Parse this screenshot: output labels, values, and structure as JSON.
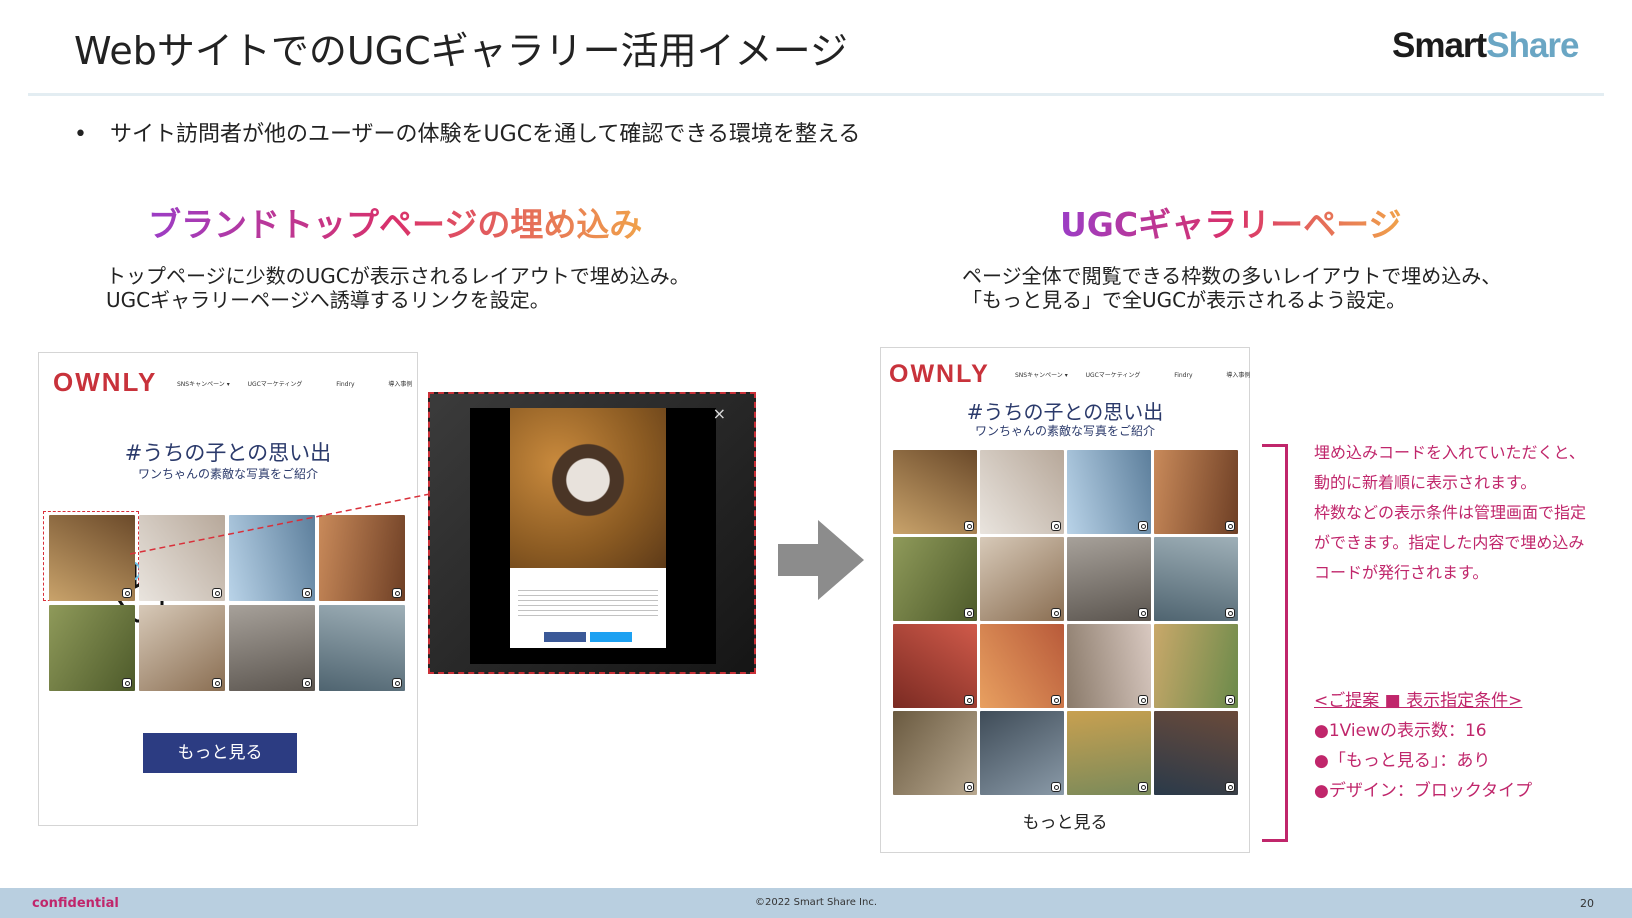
{
  "header": {
    "title": "WebサイトでのUGCギャラリー活用イメージ",
    "logo_part1": "Smart",
    "logo_part2": "Share"
  },
  "bullet": "サイト訪問者が他のユーザーの体験をUGCを通して確認できる環境を整える",
  "left_section": {
    "title": "ブランドトップページの埋め込み",
    "desc_line1": "トップページに少数のUGCが表示されるレイアウトで埋め込み。",
    "desc_line2": "UGCギャラリーページへ誘導するリンクを設定。"
  },
  "right_section": {
    "title": "UGCギャラリーページ",
    "desc_line1": "ページ全体で閲覧できる枠数の多いレイアウトで埋め込み、",
    "desc_line2": "「もっと見る」で全UGCが表示されるよう設定。"
  },
  "mock": {
    "brand": "OWNLY",
    "nav": [
      "SNSキャンペーン ▾",
      "UGCマーケティング",
      "Findry",
      "導入事例"
    ],
    "hashtag": "#うちの子との思い出",
    "subtitle": "ワンちゃんの素敵な写真をご紹介",
    "more_button": "もっと見る",
    "close_glyph": "×"
  },
  "note": {
    "line1": "埋め込みコードを入れていただくと、",
    "line2": "動的に新着順に表示されます。",
    "line3": "枠数などの表示条件は管理画面で指定",
    "line4": "ができます。指定した内容で埋め込み",
    "line5": "コードが発行されます。"
  },
  "conditions": {
    "heading": "<ご提案 ■ 表示指定条件>",
    "item1": "●1Viewの表示数：16",
    "item2": "●「もっと見る」：あり",
    "item3": "●デザイン：ブロックタイプ"
  },
  "footer": {
    "confidential": "confidential",
    "copyright": "©2022 Smart Share Inc.",
    "page": "20"
  },
  "colors": {
    "accent": "#c0266b",
    "brand_red": "#c8323b",
    "button_navy": "#2c3c82",
    "footer_bar": "#b9cfe0",
    "logo_blue": "#6aa6c4"
  }
}
